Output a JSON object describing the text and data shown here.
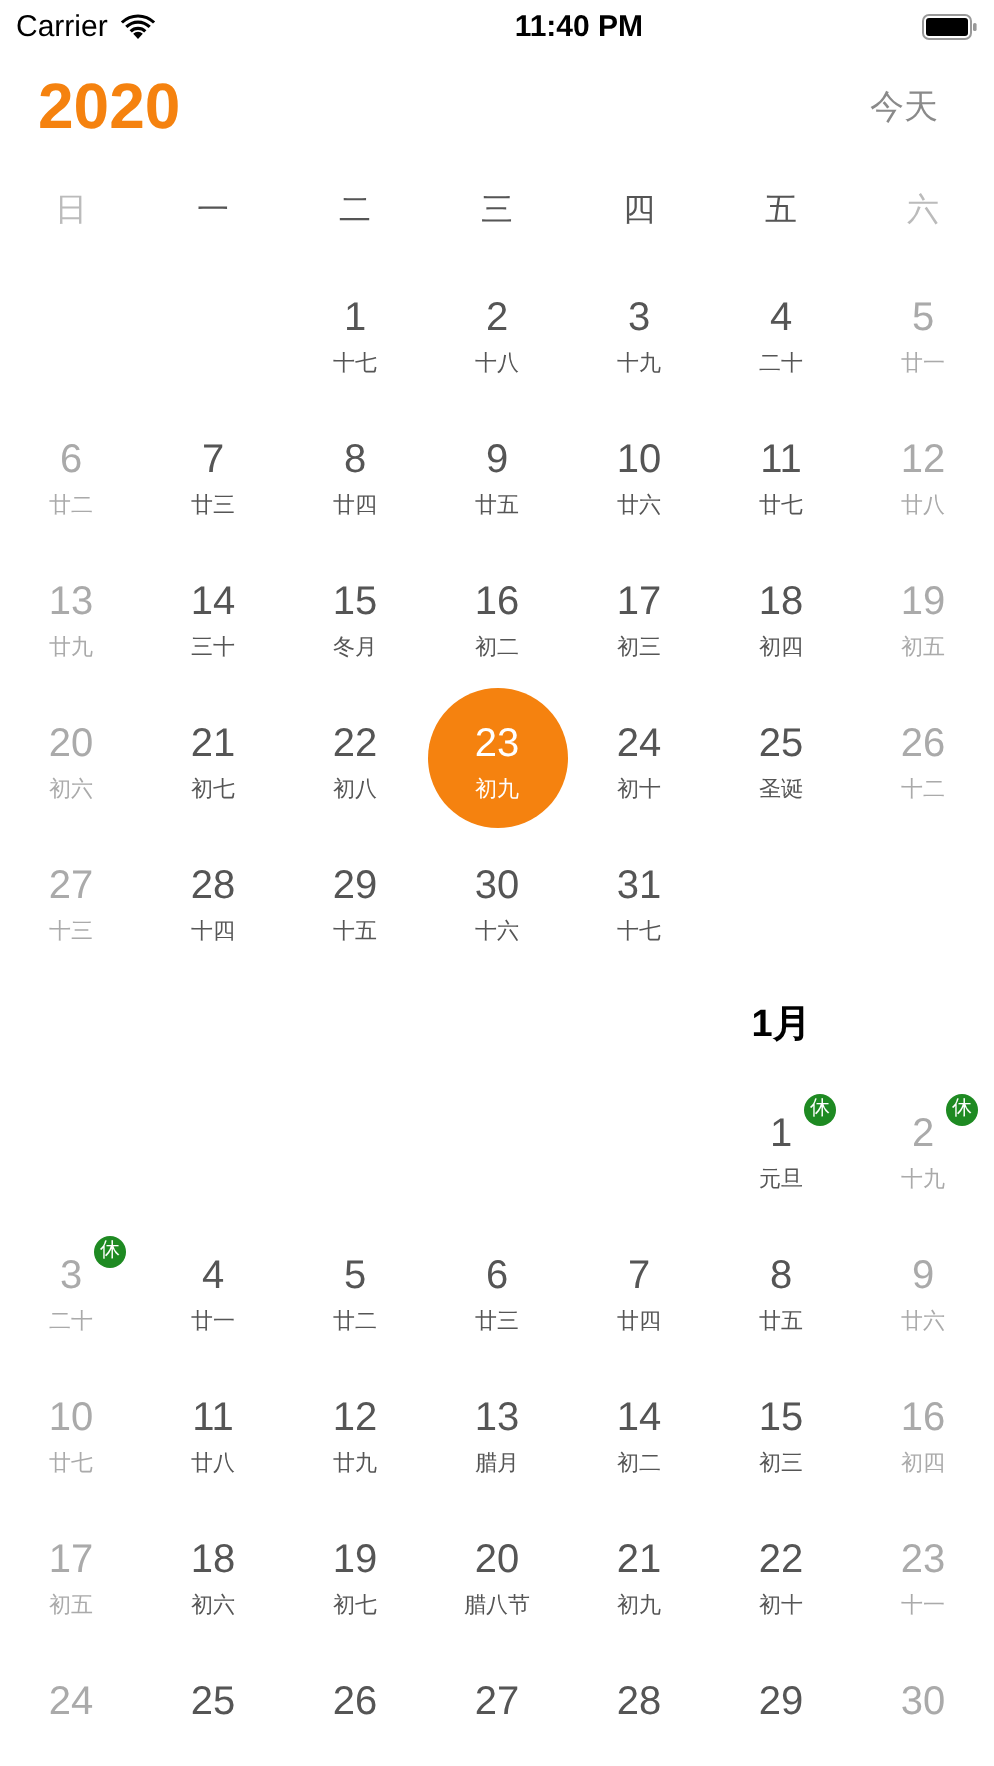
{
  "status_bar": {
    "carrier": "Carrier",
    "time": "11:40 PM"
  },
  "header": {
    "year": "2020",
    "today_button": "今天"
  },
  "weekdays": [
    "日",
    "一",
    "二",
    "三",
    "四",
    "五",
    "六"
  ],
  "months": [
    {
      "days": [
        {
          "kind": "blank"
        },
        {
          "kind": "blank"
        },
        {
          "kind": "day",
          "day": "1",
          "lunar": "十七",
          "selected": false
        },
        {
          "kind": "day",
          "day": "2",
          "lunar": "十八",
          "selected": false
        },
        {
          "kind": "day",
          "day": "3",
          "lunar": "十九",
          "selected": false
        },
        {
          "kind": "day",
          "day": "4",
          "lunar": "二十",
          "selected": false
        },
        {
          "kind": "day",
          "day": "5",
          "lunar": "廿一",
          "selected": false
        },
        {
          "kind": "day",
          "day": "6",
          "lunar": "廿二",
          "selected": false
        },
        {
          "kind": "day",
          "day": "7",
          "lunar": "廿三",
          "selected": false
        },
        {
          "kind": "day",
          "day": "8",
          "lunar": "廿四",
          "selected": false
        },
        {
          "kind": "day",
          "day": "9",
          "lunar": "廿五",
          "selected": false
        },
        {
          "kind": "day",
          "day": "10",
          "lunar": "廿六",
          "selected": false
        },
        {
          "kind": "day",
          "day": "11",
          "lunar": "廿七",
          "selected": false
        },
        {
          "kind": "day",
          "day": "12",
          "lunar": "廿八",
          "selected": false
        },
        {
          "kind": "day",
          "day": "13",
          "lunar": "廿九",
          "selected": false
        },
        {
          "kind": "day",
          "day": "14",
          "lunar": "三十",
          "selected": false
        },
        {
          "kind": "day",
          "day": "15",
          "lunar": "冬月",
          "selected": false
        },
        {
          "kind": "day",
          "day": "16",
          "lunar": "初二",
          "selected": false
        },
        {
          "kind": "day",
          "day": "17",
          "lunar": "初三",
          "selected": false
        },
        {
          "kind": "day",
          "day": "18",
          "lunar": "初四",
          "selected": false
        },
        {
          "kind": "day",
          "day": "19",
          "lunar": "初五",
          "selected": false
        },
        {
          "kind": "day",
          "day": "20",
          "lunar": "初六",
          "selected": false
        },
        {
          "kind": "day",
          "day": "21",
          "lunar": "初七",
          "selected": false
        },
        {
          "kind": "day",
          "day": "22",
          "lunar": "初八",
          "selected": false
        },
        {
          "kind": "day",
          "day": "23",
          "lunar": "初九",
          "selected": true
        },
        {
          "kind": "day",
          "day": "24",
          "lunar": "初十",
          "selected": false
        },
        {
          "kind": "day",
          "day": "25",
          "lunar": "圣诞",
          "selected": false
        },
        {
          "kind": "day",
          "day": "26",
          "lunar": "十二",
          "selected": false
        },
        {
          "kind": "day",
          "day": "27",
          "lunar": "十三",
          "selected": false
        },
        {
          "kind": "day",
          "day": "28",
          "lunar": "十四",
          "selected": false
        },
        {
          "kind": "day",
          "day": "29",
          "lunar": "十五",
          "selected": false
        },
        {
          "kind": "day",
          "day": "30",
          "lunar": "十六",
          "selected": false
        },
        {
          "kind": "day",
          "day": "31",
          "lunar": "十七",
          "selected": false
        }
      ]
    },
    {
      "title": "1月",
      "days": [
        {
          "kind": "blank"
        },
        {
          "kind": "blank"
        },
        {
          "kind": "blank"
        },
        {
          "kind": "blank"
        },
        {
          "kind": "blank"
        },
        {
          "kind": "day",
          "day": "1",
          "lunar": "元旦",
          "selected": false,
          "badge": "休"
        },
        {
          "kind": "day",
          "day": "2",
          "lunar": "十九",
          "selected": false,
          "badge": "休"
        },
        {
          "kind": "day",
          "day": "3",
          "lunar": "二十",
          "selected": false,
          "badge": "休"
        },
        {
          "kind": "day",
          "day": "4",
          "lunar": "廿一",
          "selected": false
        },
        {
          "kind": "day",
          "day": "5",
          "lunar": "廿二",
          "selected": false
        },
        {
          "kind": "day",
          "day": "6",
          "lunar": "廿三",
          "selected": false
        },
        {
          "kind": "day",
          "day": "7",
          "lunar": "廿四",
          "selected": false
        },
        {
          "kind": "day",
          "day": "8",
          "lunar": "廿五",
          "selected": false
        },
        {
          "kind": "day",
          "day": "9",
          "lunar": "廿六",
          "selected": false
        },
        {
          "kind": "day",
          "day": "10",
          "lunar": "廿七",
          "selected": false
        },
        {
          "kind": "day",
          "day": "11",
          "lunar": "廿八",
          "selected": false
        },
        {
          "kind": "day",
          "day": "12",
          "lunar": "廿九",
          "selected": false
        },
        {
          "kind": "day",
          "day": "13",
          "lunar": "腊月",
          "selected": false
        },
        {
          "kind": "day",
          "day": "14",
          "lunar": "初二",
          "selected": false
        },
        {
          "kind": "day",
          "day": "15",
          "lunar": "初三",
          "selected": false
        },
        {
          "kind": "day",
          "day": "16",
          "lunar": "初四",
          "selected": false
        },
        {
          "kind": "day",
          "day": "17",
          "lunar": "初五",
          "selected": false
        },
        {
          "kind": "day",
          "day": "18",
          "lunar": "初六",
          "selected": false
        },
        {
          "kind": "day",
          "day": "19",
          "lunar": "初七",
          "selected": false
        },
        {
          "kind": "day",
          "day": "20",
          "lunar": "腊八节",
          "selected": false
        },
        {
          "kind": "day",
          "day": "21",
          "lunar": "初九",
          "selected": false
        },
        {
          "kind": "day",
          "day": "22",
          "lunar": "初十",
          "selected": false
        },
        {
          "kind": "day",
          "day": "23",
          "lunar": "十一",
          "selected": false
        },
        {
          "kind": "day",
          "day": "24",
          "selected": false
        },
        {
          "kind": "day",
          "day": "25",
          "selected": false
        },
        {
          "kind": "day",
          "day": "26",
          "selected": false
        },
        {
          "kind": "day",
          "day": "27",
          "selected": false
        },
        {
          "kind": "day",
          "day": "28",
          "selected": false
        },
        {
          "kind": "day",
          "day": "29",
          "selected": false
        },
        {
          "kind": "day",
          "day": "30",
          "selected": false
        }
      ]
    }
  ]
}
